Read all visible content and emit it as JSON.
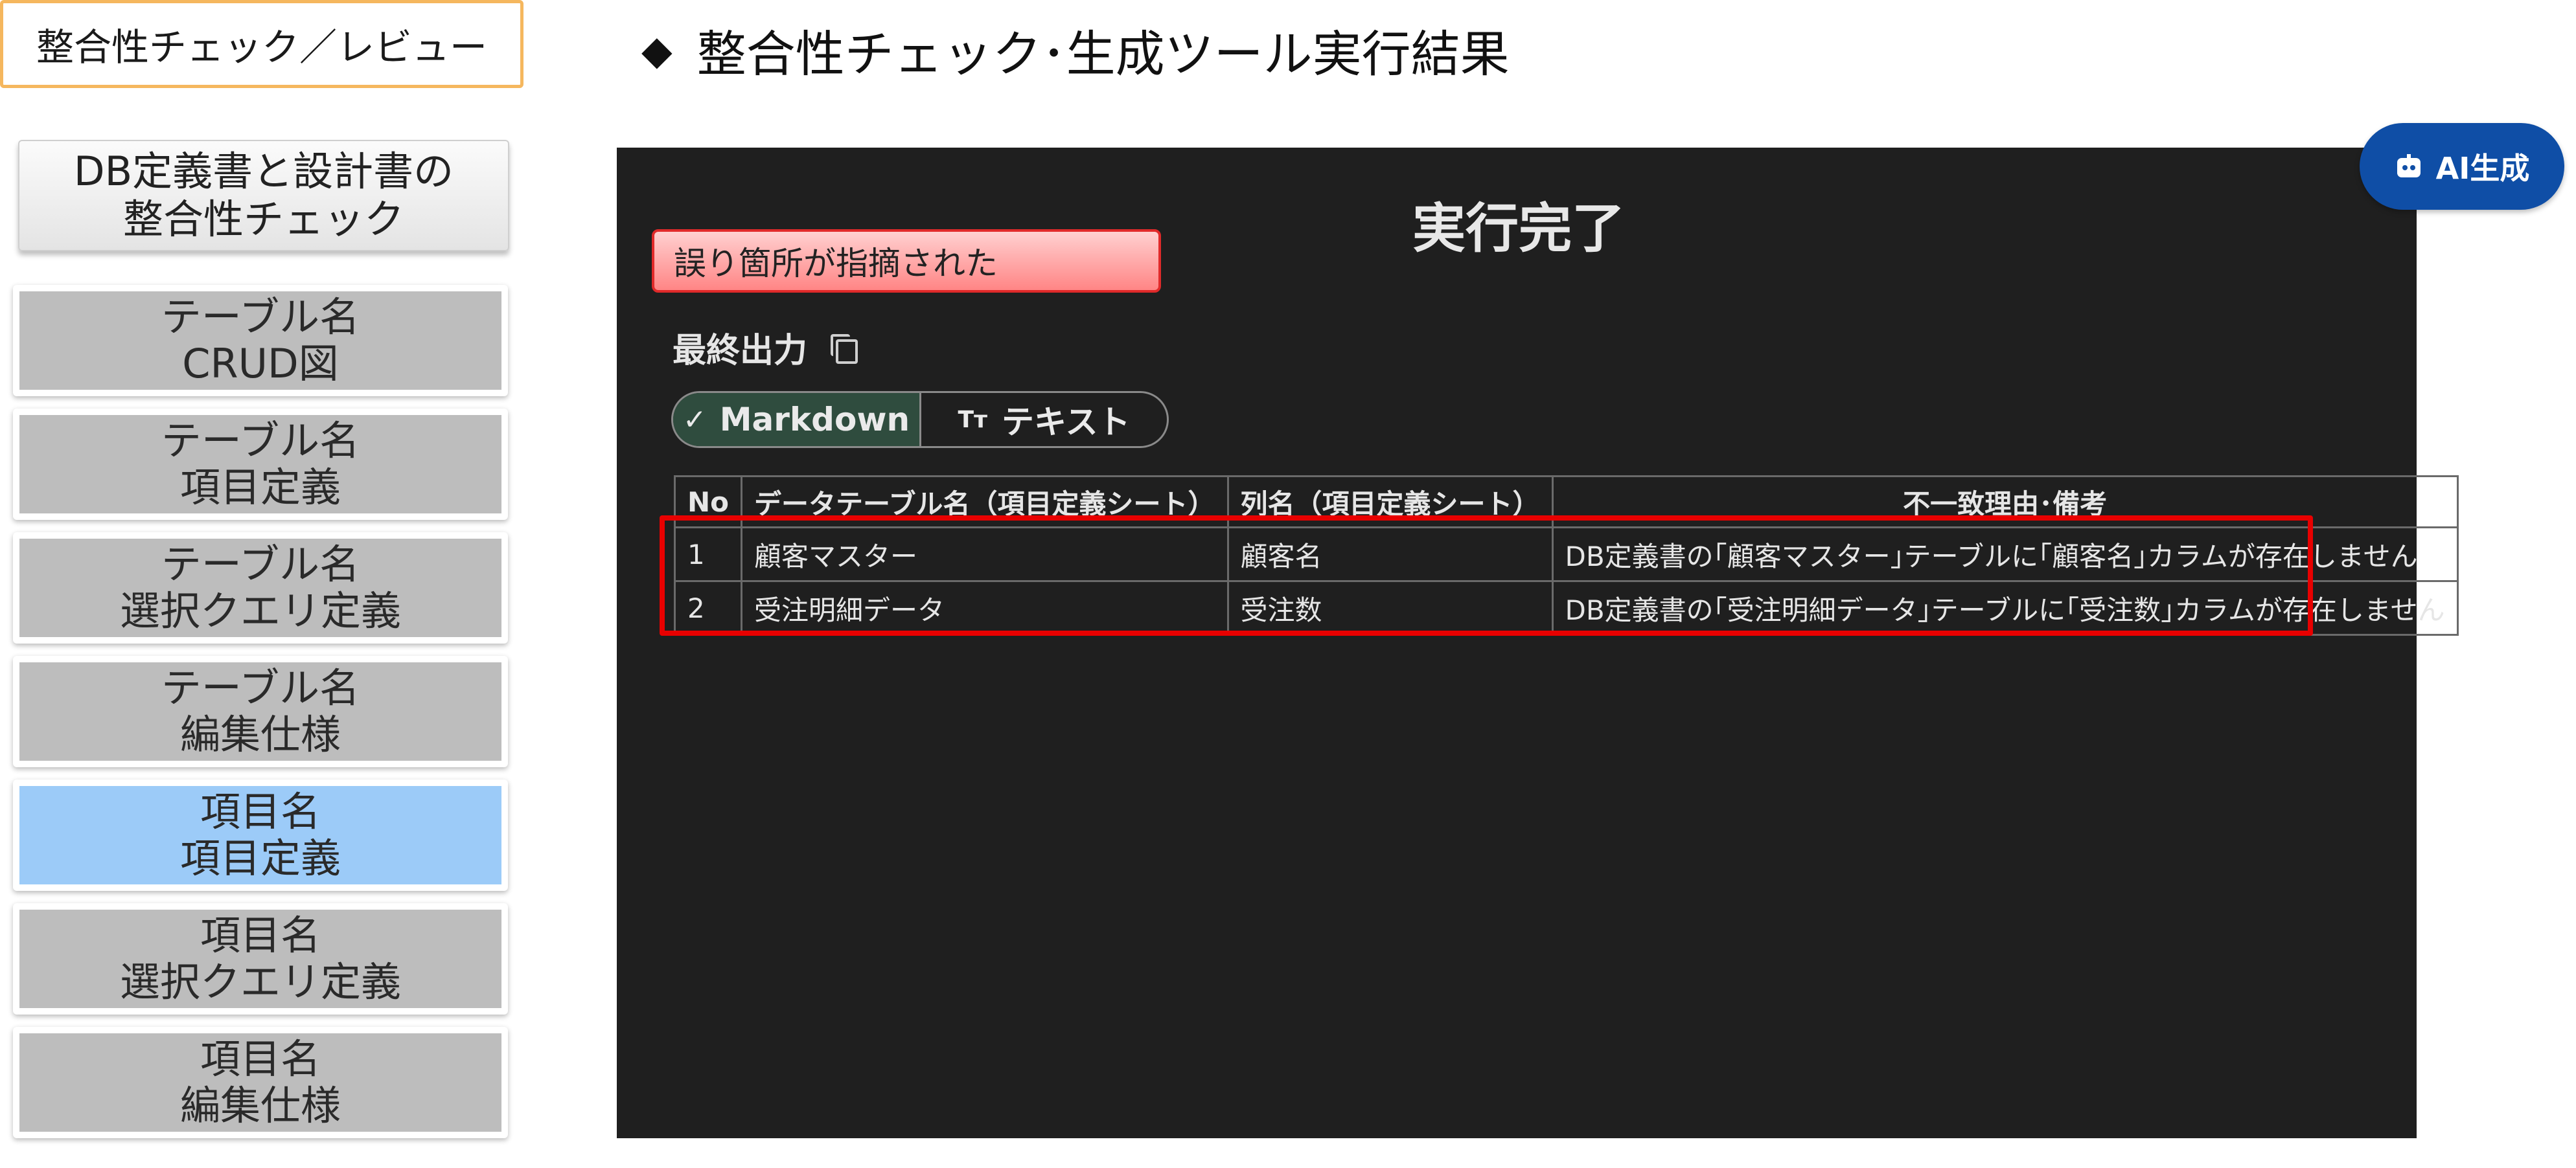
{
  "top_tag": "整合性チェック／レビュー",
  "heading": {
    "bullet": "◆",
    "text": "整合性チェック･生成ツール実行結果"
  },
  "sidebar": {
    "main_button": {
      "line1": "DB定義書と設計書の",
      "line2": "整合性チェック"
    },
    "items": [
      {
        "line1": "テーブル名",
        "line2": "CRUD図"
      },
      {
        "line1": "テーブル名",
        "line2": "項目定義"
      },
      {
        "line1": "テーブル名",
        "line2": "選択クエリ定義"
      },
      {
        "line1": "テーブル名",
        "line2": "編集仕様"
      },
      {
        "line1": "項目名",
        "line2": "項目定義",
        "active": true
      },
      {
        "line1": "項目名",
        "line2": "選択クエリ定義"
      },
      {
        "line1": "項目名",
        "line2": "編集仕様"
      }
    ]
  },
  "panel": {
    "title": "実行完了",
    "alert": "誤り箇所が指摘された",
    "final_output_label": "最終出力",
    "toggle": {
      "markdown": "Markdown",
      "text": "テキスト",
      "text_icon": "Tт",
      "selected": "markdown"
    },
    "table": {
      "headers": [
        "No",
        "データテーブル名（項目定義シート）",
        "列名（項目定義シート）",
        "不一致理由･備考"
      ],
      "rows": [
        [
          "1",
          "顧客マスター",
          "顧客名",
          "DB定義書の｢顧客マスター｣テーブルに｢顧客名｣カラムが存在しません"
        ],
        [
          "2",
          "受注明細データ",
          "受注数",
          "DB定義書の｢受注明細データ｣テーブルに｢受注数｣カラムが存在しません"
        ]
      ]
    }
  },
  "ai_badge": {
    "label": "AI生成",
    "icon": "robot-icon"
  },
  "colors": {
    "panel_bg": "#1f1f1f",
    "highlight": "#e80000",
    "active_item": "#9ccbf8",
    "badge": "#0f4ea6",
    "tag_border": "#f5b75e"
  }
}
